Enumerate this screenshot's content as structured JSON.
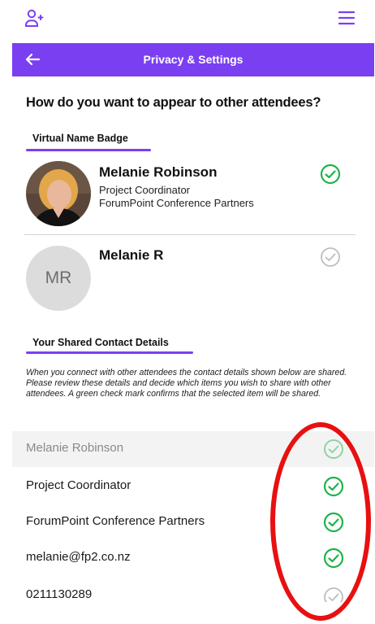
{
  "app": {
    "accent": "#7b3ff2",
    "check_on": "#1fb34a",
    "check_off": "#bdbdbd"
  },
  "topbar": {
    "left_icon": "add-user-icon",
    "right_icon": "menu-icon"
  },
  "header": {
    "title": "Privacy & Settings",
    "back_icon": "arrow-left-icon"
  },
  "question": "How do you want to appear to other attendees?",
  "badge_section": {
    "label": "Virtual Name Badge",
    "options": [
      {
        "name": "Melanie Robinson",
        "title": "Project Coordinator",
        "company": "ForumPoint Conference Partners",
        "selected": true
      },
      {
        "name": "Melanie R",
        "initials": "MR",
        "selected": false
      }
    ]
  },
  "contact_section": {
    "label": "Your Shared Contact Details",
    "description": "When you connect with other attendees the contact details shown below are shared. Please review these details and decide which items you wish to share with other attendees. A green check mark confirms that the selected item will be shared.",
    "items": [
      {
        "value": "Melanie Robinson",
        "shared": true,
        "locked": true
      },
      {
        "value": "Project Coordinator",
        "shared": true
      },
      {
        "value": "ForumPoint Conference Partners",
        "shared": true
      },
      {
        "value": "melanie@fp2.co.nz",
        "shared": true
      },
      {
        "value": "0211130289",
        "shared": false
      }
    ]
  }
}
